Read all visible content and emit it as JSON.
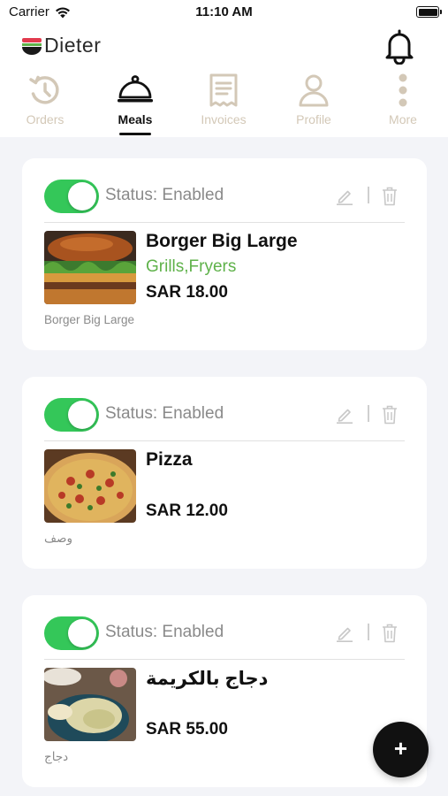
{
  "status_bar": {
    "carrier": "Carrier",
    "time": "11:10 AM"
  },
  "app": {
    "logo_text": "Dieter"
  },
  "nav": {
    "tabs": [
      {
        "label": "Orders",
        "icon": "history-icon",
        "active": false
      },
      {
        "label": "Meals",
        "icon": "cloche-icon",
        "active": true
      },
      {
        "label": "Invoices",
        "icon": "receipt-icon",
        "active": false
      },
      {
        "label": "Profile",
        "icon": "person-icon",
        "active": false
      },
      {
        "label": "More",
        "icon": "more-vertical-icon",
        "active": false
      }
    ]
  },
  "meals": [
    {
      "status": "Status: Enabled",
      "enabled": true,
      "name": "Borger Big Large",
      "categories": "Grills,Fryers",
      "price": "SAR 18.00",
      "description": "Borger Big Large",
      "image": "burger-photo"
    },
    {
      "status": "Status: Enabled",
      "enabled": true,
      "name": "Pizza",
      "categories": "",
      "price": "SAR 12.00",
      "description": "وصف",
      "image": "pizza-photo"
    },
    {
      "status": "Status: Enabled",
      "enabled": true,
      "name": "دجاج بالكريمة",
      "categories": "",
      "price": "SAR 55.00",
      "description": "دجاج",
      "image": "chicken-rice-photo"
    }
  ],
  "fab": {
    "label": "+"
  },
  "colors": {
    "accent_green": "#34c759",
    "category_green": "#5fb24a",
    "inactive_nav": "#d3c8b7",
    "background": "#f3f4f8"
  }
}
